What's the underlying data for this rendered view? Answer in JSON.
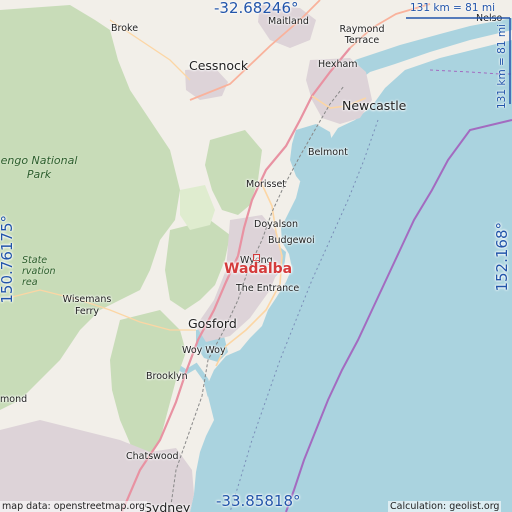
{
  "map": {
    "colors": {
      "water": "#aad3df",
      "land": "#f2efe9",
      "forest": "#c8dcb8",
      "park": "#dfeccf",
      "urban": "#ddd3d8",
      "motorway": "#e892a2",
      "trunk": "#f9b29c",
      "primary": "#fcd6a4",
      "coord_text": "#2255aa",
      "marker": "#d43b3b"
    },
    "location_label": "Wadalba",
    "coords": {
      "top": "-32.68246°",
      "bottom": "-33.85818°",
      "left": "150.76175°",
      "right": "152.168°"
    },
    "scale": {
      "horizontal": "131 km = 81 mi",
      "vertical": "131 km = 81 mi"
    },
    "attribution": "map data: openstreetmap.org",
    "calculation": "Calculation: geolist.org",
    "places": [
      {
        "id": "broke",
        "name": "Broke"
      },
      {
        "id": "maitland",
        "name": "Maitland"
      },
      {
        "id": "raymond-terrace",
        "name": "Raymond Terrace"
      },
      {
        "id": "nelson",
        "name": "Nelso"
      },
      {
        "id": "cessnock",
        "name": "Cessnock"
      },
      {
        "id": "hexham",
        "name": "Hexham"
      },
      {
        "id": "newcastle",
        "name": "Newcastle"
      },
      {
        "id": "belmont",
        "name": "Belmont"
      },
      {
        "id": "morisset",
        "name": "Morisset"
      },
      {
        "id": "doyalson",
        "name": "Doyalson"
      },
      {
        "id": "budgewoi",
        "name": "Budgewoi"
      },
      {
        "id": "wyong",
        "name": "Wyong"
      },
      {
        "id": "the-entrance",
        "name": "The Entrance"
      },
      {
        "id": "gosford",
        "name": "Gosford"
      },
      {
        "id": "woy-woy",
        "name": "Woy Woy"
      },
      {
        "id": "brooklyn",
        "name": "Brooklyn"
      },
      {
        "id": "wisemans-ferry",
        "name": "Wisemans Ferry"
      },
      {
        "id": "chatswood",
        "name": "Chatswood"
      },
      {
        "id": "sydney",
        "name": "Sydney"
      },
      {
        "id": "ormond",
        "name": "mond"
      }
    ],
    "parks": [
      {
        "id": "yengo",
        "name": "engo National Park"
      },
      {
        "id": "state-conservation",
        "name": "State rvation rea"
      }
    ]
  }
}
